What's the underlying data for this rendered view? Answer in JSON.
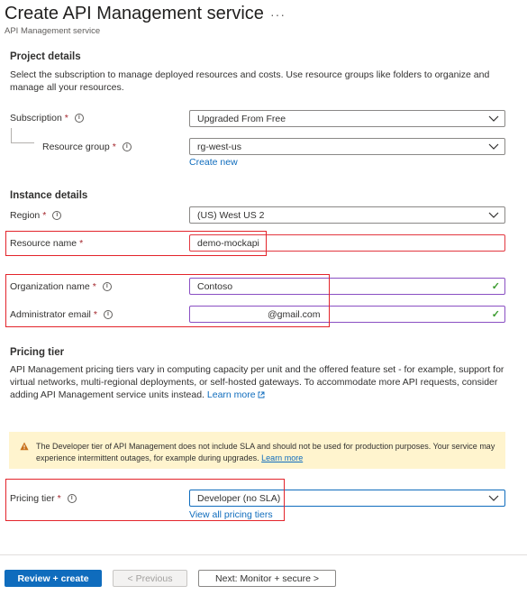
{
  "header": {
    "title": "Create API Management service",
    "more_label": "···",
    "subtitle": "API Management service"
  },
  "project": {
    "title": "Project details",
    "description": "Select the subscription to manage deployed resources and costs. Use resource groups like folders to organize and manage all your resources.",
    "subscription_label": "Subscription",
    "subscription_value": "Upgraded From Free",
    "resource_group_label": "Resource group",
    "resource_group_value": "rg-west-us",
    "create_new": "Create new"
  },
  "instance": {
    "title": "Instance details",
    "region_label": "Region",
    "region_value": "(US) West US 2",
    "resource_name_label": "Resource name",
    "resource_name_value": "demo-mockapi",
    "org_name_label": "Organization name",
    "org_name_value": "Contoso",
    "admin_email_label": "Administrator email",
    "admin_email_value": "@gmail.com"
  },
  "pricing": {
    "title": "Pricing tier",
    "description": "API Management pricing tiers vary in computing capacity per unit and the offered feature set - for example, support for virtual networks, multi-regional deployments, or self-hosted gateways. To accommodate more API requests, consider adding API Management service units instead.",
    "learn_more": "Learn more",
    "banner_text": "The Developer tier of API Management does not include SLA and should not be used for production purposes. Your service may experience intermittent outages, for example during upgrades.",
    "banner_link": "Learn more",
    "tier_label": "Pricing tier",
    "tier_value": "Developer (no SLA)",
    "view_all": "View all pricing tiers"
  },
  "footer": {
    "review_create": "Review + create",
    "previous": "< Previous",
    "next": "Next: Monitor + secure >"
  },
  "common": {
    "required_mark": "*",
    "info_glyph": "i",
    "check_glyph": "✓"
  },
  "colors": {
    "primary": "#0f6cbd",
    "highlight": "#e3242b",
    "required": "#a4262c",
    "valid": "#3a9b2e",
    "banner_bg": "#fff4ce"
  }
}
